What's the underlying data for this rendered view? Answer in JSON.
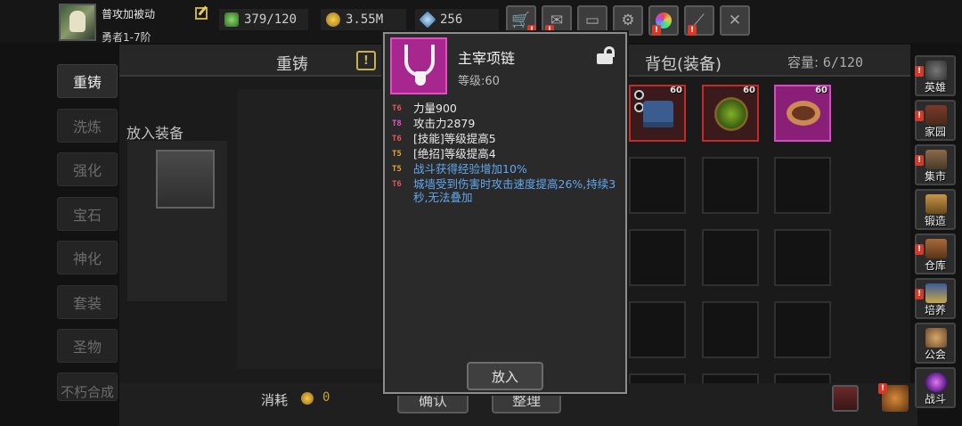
{
  "player": {
    "name": "普攻加被动",
    "rank": "勇者1-7阶"
  },
  "resources": {
    "energy": "379/120",
    "gold": "3.55M",
    "gems": "256"
  },
  "left_tabs": [
    {
      "label": "重铸"
    },
    {
      "label": "洗炼"
    },
    {
      "label": "强化"
    },
    {
      "label": "宝石"
    },
    {
      "label": "神化"
    },
    {
      "label": "套装"
    },
    {
      "label": "圣物"
    },
    {
      "label": "不朽合成"
    }
  ],
  "forge": {
    "title": "重铸",
    "help": "!",
    "put_label": "放入装备",
    "cost_label": "消耗",
    "cost_value": "0",
    "confirm": "确认"
  },
  "bag": {
    "title": "背包(装备)",
    "capacity_label": "容量:",
    "capacity_value": "6/120",
    "sort": "整理",
    "item_levels": [
      "60",
      "60",
      "60"
    ]
  },
  "tooltip": {
    "name": "主宰项链",
    "level": "等级:60",
    "attributes": [
      {
        "tier": "T6",
        "text": "力量900",
        "tier_color": "#e0585a",
        "text_color": "#e9e9e9"
      },
      {
        "tier": "T8",
        "text": "攻击力2879",
        "tier_color": "#e152c4",
        "text_color": "#e9e9e9"
      },
      {
        "tier": "T6",
        "text": "[技能]等级提高5",
        "tier_color": "#e0585a",
        "text_color": "#e9e9e9"
      },
      {
        "tier": "T5",
        "text": "[绝招]等级提高4",
        "tier_color": "#e2a43a",
        "text_color": "#e9e9e9"
      },
      {
        "tier": "T5",
        "text": "战斗获得经验增加10%",
        "tier_color": "#e2a43a",
        "text_color": "#61a8ef"
      },
      {
        "tier": "T6",
        "text": "城墙受到伤害时攻击速度提高26%,持续3秒,无法叠加",
        "tier_color": "#e0585a",
        "text_color": "#61a8ef"
      }
    ],
    "place": "放入"
  },
  "right_nav": [
    {
      "label": "英雄",
      "icon": "knight-helmet-icon"
    },
    {
      "label": "家园",
      "icon": "home-icon"
    },
    {
      "label": "集市",
      "icon": "market-icon"
    },
    {
      "label": "锻造",
      "icon": "anvil-icon"
    },
    {
      "label": "仓库",
      "icon": "warehouse-icon"
    },
    {
      "label": "培养",
      "icon": "training-icon"
    },
    {
      "label": "公会",
      "icon": "guild-icon"
    },
    {
      "label": "战斗",
      "icon": "battle-portal-icon"
    }
  ],
  "top_buttons": [
    "shop-cart-icon",
    "mail-icon",
    "gamepad-icon",
    "settings-gear-icon",
    "color-wheel-icon",
    "sword-icon",
    "crossed-swords-icon"
  ],
  "colors": {
    "epic_pink": "#a8278e",
    "rare_red": "#c32a2a",
    "alert_red": "#d23a2a",
    "gold": "#c2a33a"
  }
}
